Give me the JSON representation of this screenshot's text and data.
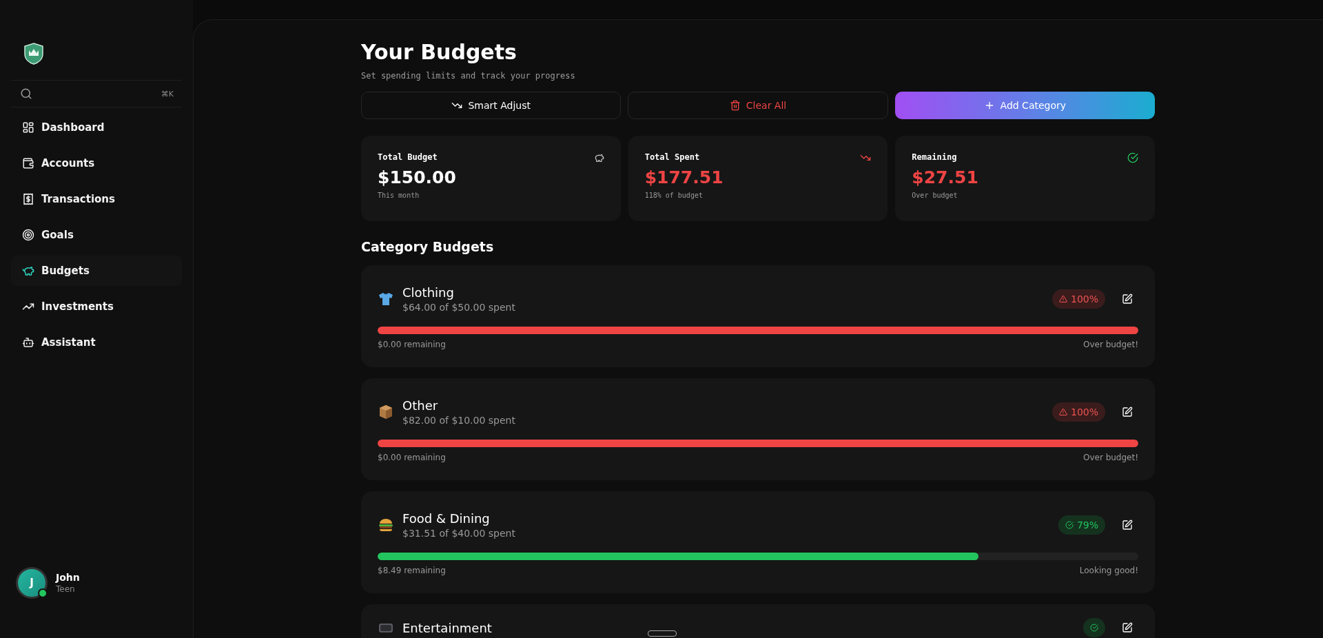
{
  "sidebar": {
    "search": {
      "shortcut": "⌘K"
    },
    "items": [
      {
        "label": "Dashboard",
        "selected": false
      },
      {
        "label": "Accounts",
        "selected": false
      },
      {
        "label": "Transactions",
        "selected": false
      },
      {
        "label": "Goals",
        "selected": false
      },
      {
        "label": "Budgets",
        "selected": true
      },
      {
        "label": "Investments",
        "selected": false
      },
      {
        "label": "Assistant",
        "selected": false
      }
    ],
    "user": {
      "initial": "J",
      "name": "John",
      "role": "Teen",
      "online": true
    }
  },
  "header": {
    "title": "Your Budgets",
    "subtitle": "Set spending limits and track your progress"
  },
  "actions": [
    {
      "label": "Smart Adjust",
      "kind": "plain"
    },
    {
      "label": "Clear All",
      "kind": "danger"
    },
    {
      "label": "Add Category",
      "kind": "primary"
    }
  ],
  "stats": [
    {
      "label": "Total Budget",
      "value": "$150.00",
      "note": "This month",
      "kind": "budget"
    },
    {
      "label": "Total Spent",
      "value": "$177.51",
      "note": "118% of budget",
      "kind": "spent"
    },
    {
      "label": "Remaining",
      "value": "$27.51",
      "note": "Over budget",
      "kind": "remaining"
    }
  ],
  "section_title": "Category Budgets",
  "categories": [
    {
      "name": "Clothing",
      "spent": "$64.00 of $50.00 spent",
      "kind": "over",
      "percent": "100%",
      "level": 1,
      "remaining": "$0.00 remaining",
      "message": "Over budget!"
    },
    {
      "name": "Other",
      "spent": "$82.00 of $10.00 spent",
      "kind": "over",
      "percent": "100%",
      "level": 1,
      "remaining": "$0.00 remaining",
      "message": "Over budget!"
    },
    {
      "name": "Food & Dining",
      "spent": "$31.51 of $40.00 spent",
      "kind": "ok",
      "percent": "79%",
      "level": 0.79,
      "remaining": "$8.49 remaining",
      "message": "Looking good!"
    },
    {
      "name": "Entertainment",
      "kind": "ok"
    }
  ]
}
